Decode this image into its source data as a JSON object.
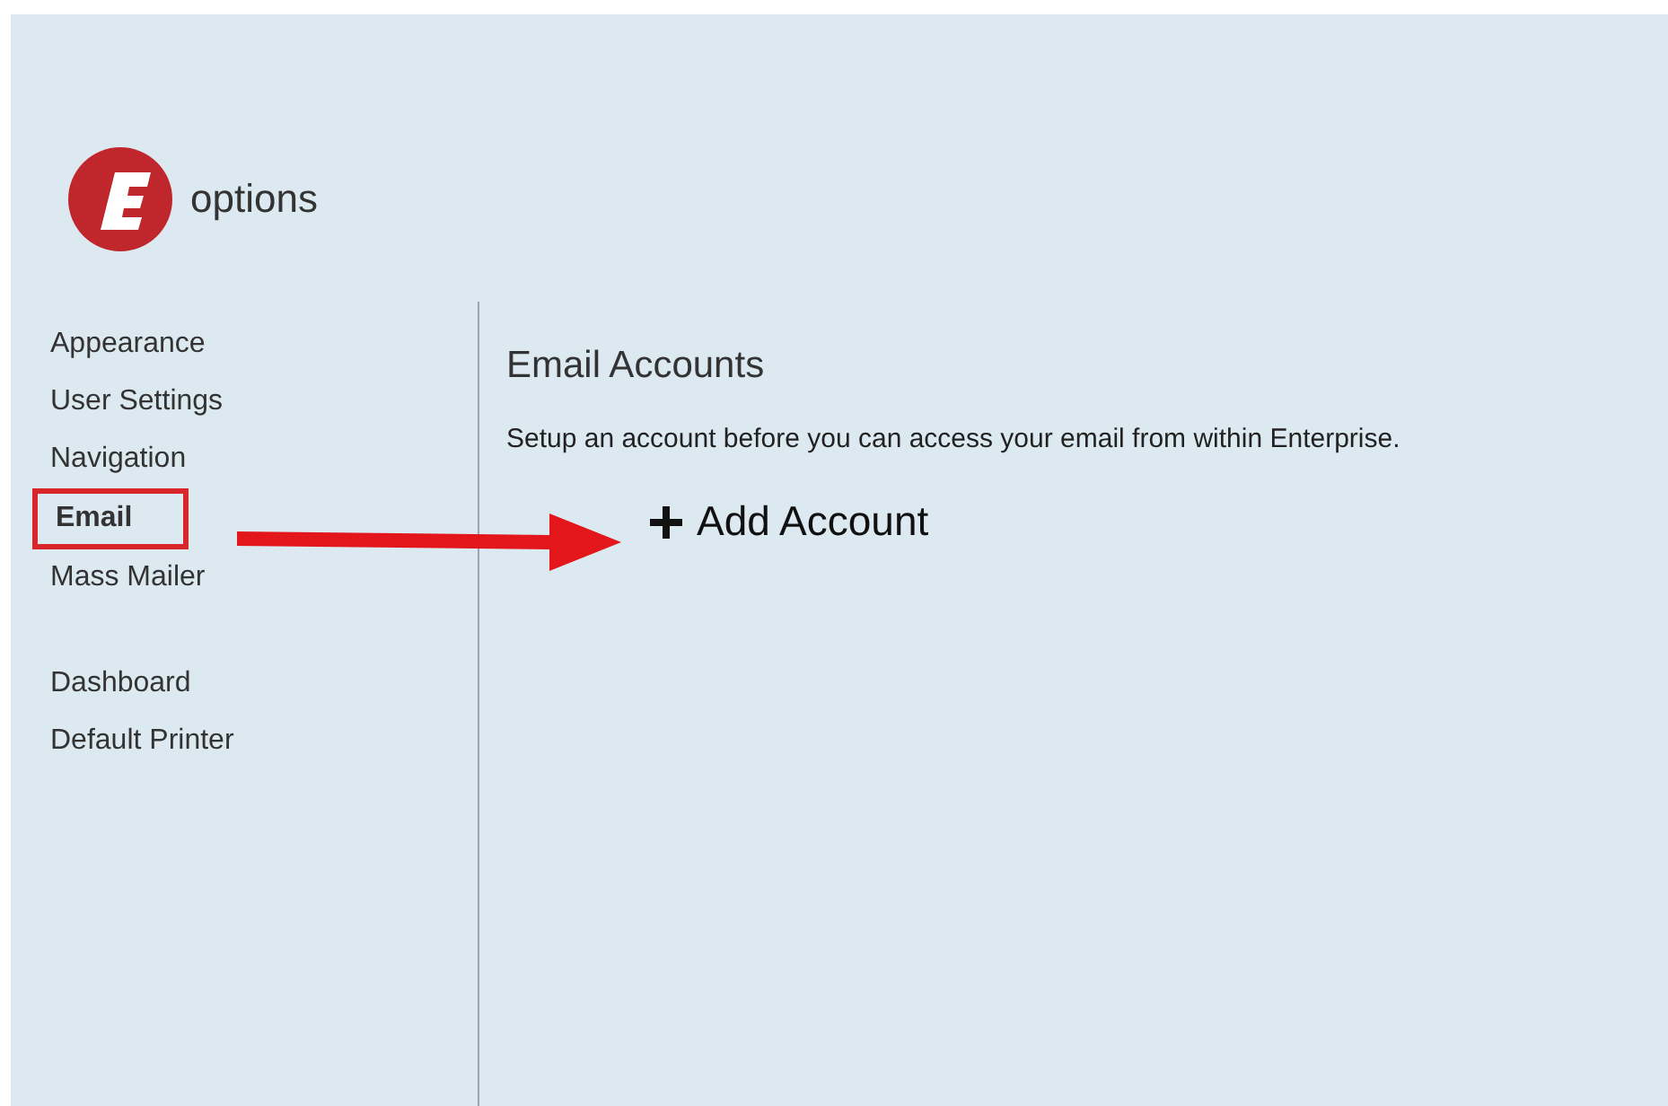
{
  "app": {
    "title": "options"
  },
  "sidebar": {
    "groups": [
      {
        "items": [
          {
            "label": "Appearance",
            "selected": false
          },
          {
            "label": "User Settings",
            "selected": false
          },
          {
            "label": "Navigation",
            "selected": false
          },
          {
            "label": "Email",
            "selected": true
          },
          {
            "label": "Mass Mailer",
            "selected": false
          }
        ]
      },
      {
        "items": [
          {
            "label": "Dashboard",
            "selected": false
          },
          {
            "label": "Default Printer",
            "selected": false
          }
        ]
      }
    ]
  },
  "content": {
    "heading": "Email Accounts",
    "description": "Setup an account before you can access your email from within Enterprise.",
    "action": "Add Account"
  }
}
